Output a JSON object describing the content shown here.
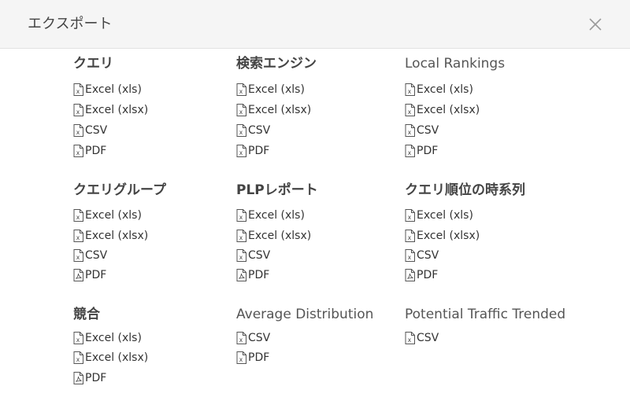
{
  "dialog": {
    "title": "エクスポート",
    "close_icon": "close-icon"
  },
  "sections": [
    {
      "title": "クエリ",
      "links": [
        {
          "label": "Excel (xls)",
          "icon": "excel-file-icon"
        },
        {
          "label": "Excel (xlsx)",
          "icon": "excel-file-icon"
        },
        {
          "label": "CSV",
          "icon": "csv-file-icon"
        },
        {
          "label": "PDF",
          "icon": "pdf-file-icon"
        }
      ]
    },
    {
      "title": "検索エンジン",
      "links": [
        {
          "label": "Excel (xls)",
          "icon": "excel-file-icon"
        },
        {
          "label": "Excel (xlsx)",
          "icon": "excel-file-icon"
        },
        {
          "label": "CSV",
          "icon": "csv-file-icon"
        },
        {
          "label": "PDF",
          "icon": "pdf-file-icon"
        }
      ]
    },
    {
      "title": "Local Rankings",
      "links": [
        {
          "label": "Excel (xls)",
          "icon": "excel-file-icon"
        },
        {
          "label": "Excel (xlsx)",
          "icon": "excel-file-icon"
        },
        {
          "label": "CSV",
          "icon": "csv-file-icon"
        },
        {
          "label": "PDF",
          "icon": "pdf-file-icon"
        }
      ]
    },
    {
      "title": "クエリグループ",
      "links": [
        {
          "label": "Excel (xls)",
          "icon": "excel-file-icon"
        },
        {
          "label": "Excel (xlsx)",
          "icon": "excel-file-icon"
        },
        {
          "label": "CSV",
          "icon": "csv-file-icon"
        },
        {
          "label": "PDF",
          "icon": "pdf-file-icon"
        }
      ]
    },
    {
      "title": "PLPレポート",
      "links": [
        {
          "label": "Excel (xls)",
          "icon": "excel-file-icon"
        },
        {
          "label": "Excel (xlsx)",
          "icon": "excel-file-icon"
        },
        {
          "label": "CSV",
          "icon": "csv-file-icon"
        },
        {
          "label": "PDF",
          "icon": "pdf-file-icon"
        }
      ]
    },
    {
      "title": "クエリ順位の時系列",
      "links": [
        {
          "label": "Excel (xls)",
          "icon": "excel-file-icon"
        },
        {
          "label": "Excel (xlsx)",
          "icon": "excel-file-icon"
        },
        {
          "label": "CSV",
          "icon": "csv-file-icon"
        },
        {
          "label": "PDF",
          "icon": "pdf-file-icon"
        }
      ]
    },
    {
      "title": "競合",
      "links": [
        {
          "label": "Excel (xls)",
          "icon": "excel-file-icon"
        },
        {
          "label": "Excel (xlsx)",
          "icon": "excel-file-icon"
        },
        {
          "label": "PDF",
          "icon": "pdf-file-icon"
        }
      ]
    },
    {
      "title": "Average Distribution",
      "links": [
        {
          "label": "CSV",
          "icon": "csv-file-icon"
        },
        {
          "label": "PDF",
          "icon": "pdf-file-icon"
        }
      ]
    },
    {
      "title": "Potential Traffic Trended",
      "links": [
        {
          "label": "CSV",
          "icon": "csv-file-icon"
        }
      ]
    }
  ]
}
